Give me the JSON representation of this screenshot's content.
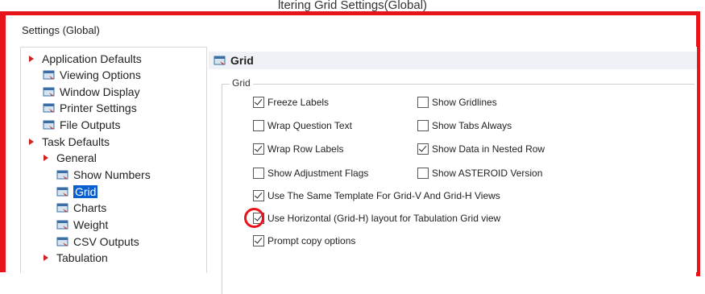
{
  "caption": "ltering Grid Settings(Global)",
  "window": {
    "title": "Settings (Global)"
  },
  "tree": {
    "items": [
      {
        "label": "Application Defaults",
        "type": "folder"
      },
      {
        "label": "Viewing Options",
        "type": "page"
      },
      {
        "label": "Window Display",
        "type": "page"
      },
      {
        "label": "Printer Settings",
        "type": "page"
      },
      {
        "label": "File Outputs",
        "type": "page"
      },
      {
        "label": "Task Defaults",
        "type": "folder"
      },
      {
        "label": "General",
        "type": "folder"
      },
      {
        "label": "Show Numbers",
        "type": "page"
      },
      {
        "label": "Grid",
        "type": "page",
        "selected": true
      },
      {
        "label": "Charts",
        "type": "page"
      },
      {
        "label": "Weight",
        "type": "page"
      },
      {
        "label": "CSV Outputs",
        "type": "page"
      },
      {
        "label": "Tabulation",
        "type": "folder"
      }
    ]
  },
  "panel": {
    "title": "Grid",
    "group_label": "Grid",
    "options": {
      "freeze_labels": {
        "label": "Freeze Labels",
        "checked": true
      },
      "show_gridlines": {
        "label": "Show Gridlines",
        "checked": false
      },
      "wrap_question_text": {
        "label": "Wrap Question Text",
        "checked": false
      },
      "show_tabs_always": {
        "label": "Show Tabs Always",
        "checked": false
      },
      "wrap_row_labels": {
        "label": "Wrap Row Labels",
        "checked": true
      },
      "show_data_nested_row": {
        "label": "Show Data in Nested Row",
        "checked": true
      },
      "show_adjustment_flags": {
        "label": "Show Adjustment Flags",
        "checked": false
      },
      "show_asteroid_version": {
        "label": "Show ASTEROID Version",
        "checked": false
      },
      "same_template": {
        "label": "Use The Same Template For Grid-V And Grid-H Views",
        "checked": true
      },
      "horizontal_layout": {
        "label": "Use Horizontal (Grid-H) layout for Tabulation Grid view",
        "checked": true
      },
      "prompt_copy": {
        "label": "Prompt copy options",
        "checked": true
      }
    }
  },
  "colors": {
    "annotation": "#e8141c",
    "selection": "#0a5fd0"
  }
}
